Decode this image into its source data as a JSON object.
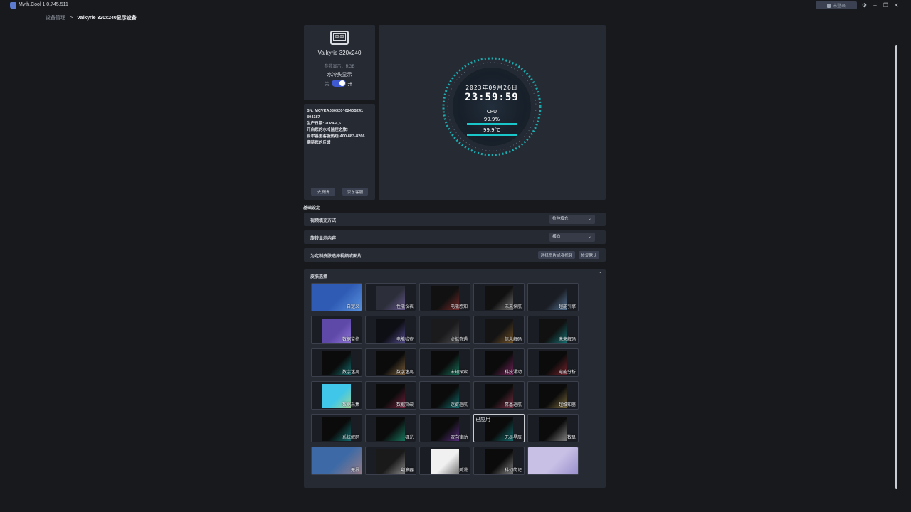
{
  "app": {
    "title": "Myth.Cool 1.0.745.511",
    "login_label": "未登录"
  },
  "breadcrumb": {
    "parent": "设备管理",
    "separator": ">",
    "current": "Valkyrie 320x240显示设备"
  },
  "device": {
    "icon_text": "00:00",
    "name": "Valkyrie 320x240",
    "subtitle": "参数显示、RGB",
    "toggle_label": "水冷头显示",
    "toggle_off": "关",
    "toggle_on": "开",
    "toggle_state": true
  },
  "info": {
    "lines": [
      "SN: MCVKA080320^0240S241",
      "804187",
      "生产日期: 2024-4,5",
      "开启您的水冷监控之旅!",
      "瓦尔基里客服热线:400-883-8266",
      "期待您的反馈"
    ],
    "feedback_button": "去反馈",
    "jd_button": "京东客服"
  },
  "preview": {
    "date": "2023年09月26日",
    "time": "23:59:59",
    "label": "CPU",
    "usage": "99.9%",
    "temp": "99.9°C",
    "accent": "#19c6c9"
  },
  "settings": {
    "section_title": "基础设定",
    "fill_label": "视频填充方式",
    "fill_value": "拉伸填充",
    "rotate_label": "旋转显示内容",
    "rotate_value": "横向",
    "custom_label": "为定制皮肤选择视频或图片",
    "choose_button": "选择图片或者视频",
    "restore_button": "恢复默认"
  },
  "skins": {
    "title": "皮肤选择",
    "active_badge": "已应用",
    "items": [
      {
        "label": "自定义"
      },
      {
        "label": "性能仪表"
      },
      {
        "label": "电能感知"
      },
      {
        "label": "未来探航"
      },
      {
        "label": "超能引擎"
      },
      {
        "label": "数据监控"
      },
      {
        "label": "电能检查"
      },
      {
        "label": "虚拟奇遇"
      },
      {
        "label": "信息解码"
      },
      {
        "label": "未来解码"
      },
      {
        "label": "数字迷离"
      },
      {
        "label": "数字迷离"
      },
      {
        "label": "未知探索"
      },
      {
        "label": "科技涌动"
      },
      {
        "label": "电能分析"
      },
      {
        "label": "数据采集"
      },
      {
        "label": "数据突破"
      },
      {
        "label": "迷雾巡航"
      },
      {
        "label": "幕基巡航"
      },
      {
        "label": "超维知器"
      },
      {
        "label": "系统解码"
      },
      {
        "label": "极光"
      },
      {
        "label": "双向律动"
      },
      {
        "label": "无尽星辰"
      },
      {
        "label": "数显"
      },
      {
        "label": "无界"
      },
      {
        "label": "翻滚器"
      },
      {
        "label": "美漫"
      },
      {
        "label": "科幻简记"
      },
      {
        "label": ""
      }
    ]
  }
}
